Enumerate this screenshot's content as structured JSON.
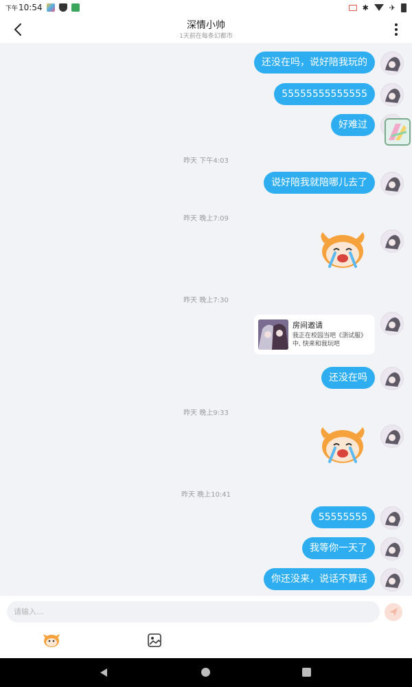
{
  "status_bar": {
    "ampm": "下午",
    "time": "10:54"
  },
  "header": {
    "title": "深情小帅",
    "subtitle": "1天前在每条幻都市"
  },
  "messages": [
    {
      "type": "text",
      "text": "还没在吗，说好陪我玩的"
    },
    {
      "type": "text",
      "text": "55555555555555"
    },
    {
      "type": "text",
      "text": "好难过"
    },
    {
      "type": "timestamp",
      "text": "昨天 下午4:03"
    },
    {
      "type": "text",
      "text": "说好陪我就陪哪儿去了"
    },
    {
      "type": "timestamp",
      "text": "昨天 晚上7:09"
    },
    {
      "type": "sticker",
      "name": "crying-sticker"
    },
    {
      "type": "timestamp",
      "text": "昨天 晚上7:30"
    },
    {
      "type": "card",
      "title": "房间邀请",
      "desc": "我正在校园当吧《测试服》中, 快来和我玩吧"
    },
    {
      "type": "text",
      "text": "还没在吗"
    },
    {
      "type": "timestamp",
      "text": "昨天 晚上9:33"
    },
    {
      "type": "sticker",
      "name": "crying-sticker"
    },
    {
      "type": "timestamp",
      "text": "昨天 晚上10:41"
    },
    {
      "type": "text",
      "text": "55555555"
    },
    {
      "type": "text",
      "text": "我等你一天了"
    },
    {
      "type": "text",
      "text": "你还没来，说话不算话"
    }
  ],
  "input": {
    "placeholder": "请输入..."
  },
  "icons": {
    "back": "back-arrow-icon",
    "more": "more-vertical-icon",
    "send": "send-icon",
    "emoji": "emoji-sticker-icon",
    "image": "image-icon"
  },
  "colors": {
    "accent": "#2eaef0",
    "send_disabled": "#f9dfd6"
  }
}
